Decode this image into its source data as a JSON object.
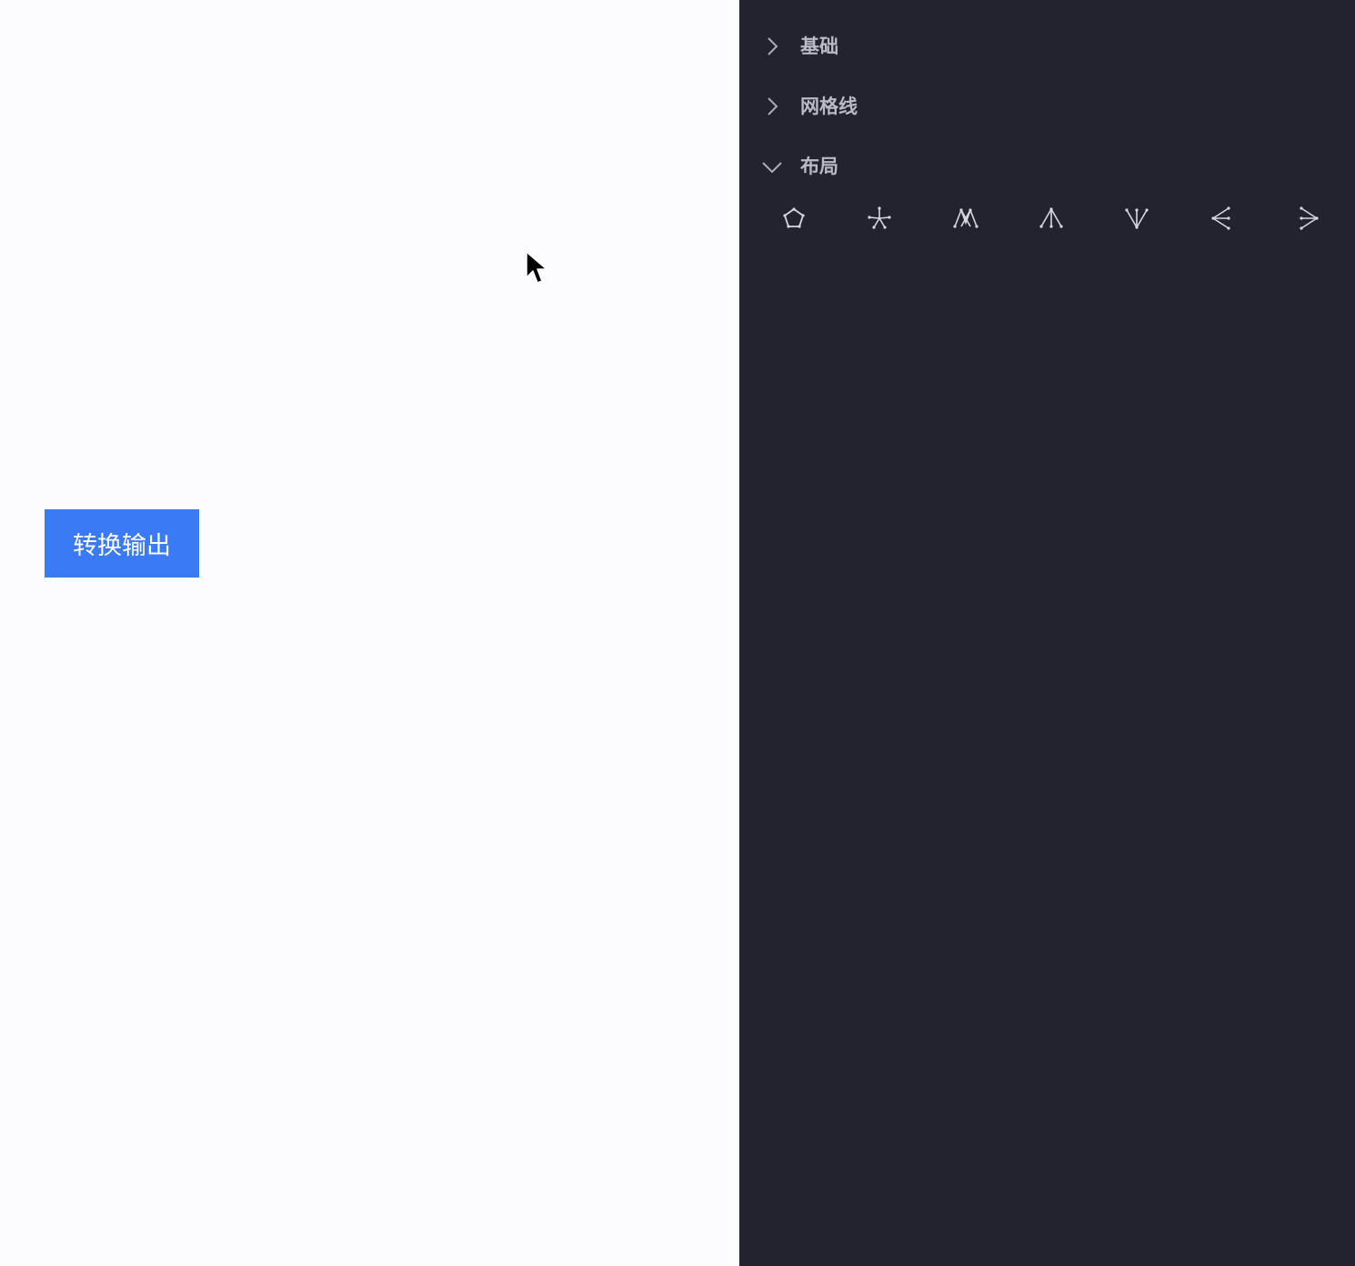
{
  "canvas": {
    "convert_button_label": "转换输出"
  },
  "panel": {
    "sections": [
      {
        "label": "基础",
        "state": "collapsed"
      },
      {
        "label": "网格线",
        "state": "collapsed"
      },
      {
        "label": "布局",
        "state": "expanded"
      }
    ],
    "layout_icons": [
      "pentagon-layout-icon",
      "star-radial-layout-icon",
      "mesh-layout-icon",
      "tree-down-layout-icon",
      "tree-up-layout-icon",
      "tree-left-layout-icon",
      "tree-right-layout-icon"
    ]
  },
  "colors": {
    "panel_bg": "#22232f",
    "canvas_bg": "#fcfcfe",
    "button_bg": "#3a7bf5",
    "label_text": "#b8bac4"
  }
}
